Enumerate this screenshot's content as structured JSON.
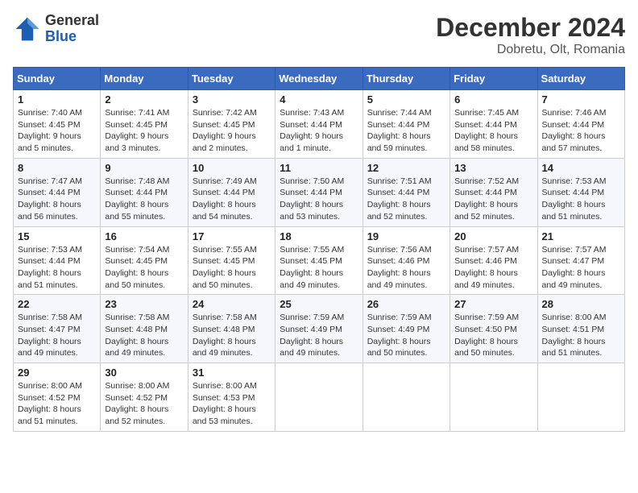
{
  "logo": {
    "line1": "General",
    "line2": "Blue"
  },
  "title": "December 2024",
  "subtitle": "Dobretu, Olt, Romania",
  "weekdays": [
    "Sunday",
    "Monday",
    "Tuesday",
    "Wednesday",
    "Thursday",
    "Friday",
    "Saturday"
  ],
  "weeks": [
    [
      {
        "day": "1",
        "sunrise": "7:40 AM",
        "sunset": "4:45 PM",
        "daylight": "9 hours and 5 minutes."
      },
      {
        "day": "2",
        "sunrise": "7:41 AM",
        "sunset": "4:45 PM",
        "daylight": "9 hours and 3 minutes."
      },
      {
        "day": "3",
        "sunrise": "7:42 AM",
        "sunset": "4:45 PM",
        "daylight": "9 hours and 2 minutes."
      },
      {
        "day": "4",
        "sunrise": "7:43 AM",
        "sunset": "4:44 PM",
        "daylight": "9 hours and 1 minute."
      },
      {
        "day": "5",
        "sunrise": "7:44 AM",
        "sunset": "4:44 PM",
        "daylight": "8 hours and 59 minutes."
      },
      {
        "day": "6",
        "sunrise": "7:45 AM",
        "sunset": "4:44 PM",
        "daylight": "8 hours and 58 minutes."
      },
      {
        "day": "7",
        "sunrise": "7:46 AM",
        "sunset": "4:44 PM",
        "daylight": "8 hours and 57 minutes."
      }
    ],
    [
      {
        "day": "8",
        "sunrise": "7:47 AM",
        "sunset": "4:44 PM",
        "daylight": "8 hours and 56 minutes."
      },
      {
        "day": "9",
        "sunrise": "7:48 AM",
        "sunset": "4:44 PM",
        "daylight": "8 hours and 55 minutes."
      },
      {
        "day": "10",
        "sunrise": "7:49 AM",
        "sunset": "4:44 PM",
        "daylight": "8 hours and 54 minutes."
      },
      {
        "day": "11",
        "sunrise": "7:50 AM",
        "sunset": "4:44 PM",
        "daylight": "8 hours and 53 minutes."
      },
      {
        "day": "12",
        "sunrise": "7:51 AM",
        "sunset": "4:44 PM",
        "daylight": "8 hours and 52 minutes."
      },
      {
        "day": "13",
        "sunrise": "7:52 AM",
        "sunset": "4:44 PM",
        "daylight": "8 hours and 52 minutes."
      },
      {
        "day": "14",
        "sunrise": "7:53 AM",
        "sunset": "4:44 PM",
        "daylight": "8 hours and 51 minutes."
      }
    ],
    [
      {
        "day": "15",
        "sunrise": "7:53 AM",
        "sunset": "4:44 PM",
        "daylight": "8 hours and 51 minutes."
      },
      {
        "day": "16",
        "sunrise": "7:54 AM",
        "sunset": "4:45 PM",
        "daylight": "8 hours and 50 minutes."
      },
      {
        "day": "17",
        "sunrise": "7:55 AM",
        "sunset": "4:45 PM",
        "daylight": "8 hours and 50 minutes."
      },
      {
        "day": "18",
        "sunrise": "7:55 AM",
        "sunset": "4:45 PM",
        "daylight": "8 hours and 49 minutes."
      },
      {
        "day": "19",
        "sunrise": "7:56 AM",
        "sunset": "4:46 PM",
        "daylight": "8 hours and 49 minutes."
      },
      {
        "day": "20",
        "sunrise": "7:57 AM",
        "sunset": "4:46 PM",
        "daylight": "8 hours and 49 minutes."
      },
      {
        "day": "21",
        "sunrise": "7:57 AM",
        "sunset": "4:47 PM",
        "daylight": "8 hours and 49 minutes."
      }
    ],
    [
      {
        "day": "22",
        "sunrise": "7:58 AM",
        "sunset": "4:47 PM",
        "daylight": "8 hours and 49 minutes."
      },
      {
        "day": "23",
        "sunrise": "7:58 AM",
        "sunset": "4:48 PM",
        "daylight": "8 hours and 49 minutes."
      },
      {
        "day": "24",
        "sunrise": "7:58 AM",
        "sunset": "4:48 PM",
        "daylight": "8 hours and 49 minutes."
      },
      {
        "day": "25",
        "sunrise": "7:59 AM",
        "sunset": "4:49 PM",
        "daylight": "8 hours and 49 minutes."
      },
      {
        "day": "26",
        "sunrise": "7:59 AM",
        "sunset": "4:49 PM",
        "daylight": "8 hours and 50 minutes."
      },
      {
        "day": "27",
        "sunrise": "7:59 AM",
        "sunset": "4:50 PM",
        "daylight": "8 hours and 50 minutes."
      },
      {
        "day": "28",
        "sunrise": "8:00 AM",
        "sunset": "4:51 PM",
        "daylight": "8 hours and 51 minutes."
      }
    ],
    [
      {
        "day": "29",
        "sunrise": "8:00 AM",
        "sunset": "4:52 PM",
        "daylight": "8 hours and 51 minutes."
      },
      {
        "day": "30",
        "sunrise": "8:00 AM",
        "sunset": "4:52 PM",
        "daylight": "8 hours and 52 minutes."
      },
      {
        "day": "31",
        "sunrise": "8:00 AM",
        "sunset": "4:53 PM",
        "daylight": "8 hours and 53 minutes."
      },
      null,
      null,
      null,
      null
    ]
  ],
  "labels": {
    "sunrise": "Sunrise:",
    "sunset": "Sunset:",
    "daylight": "Daylight:"
  }
}
